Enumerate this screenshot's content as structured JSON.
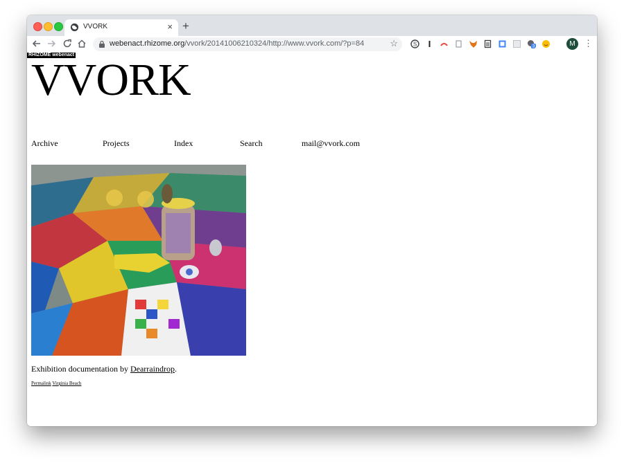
{
  "browser": {
    "tab_title": "VVORK",
    "url_host": "webenact.rhizome.org",
    "url_path": "/vvork/20141006210324/http://www.vvork.com/?p=84",
    "profile_initial": "M",
    "extension_badge": "3"
  },
  "wayback": {
    "badge": "RHIZOME webenact"
  },
  "site": {
    "title": "VVORK",
    "nav": [
      {
        "label": "Archive"
      },
      {
        "label": "Projects"
      },
      {
        "label": "Index"
      },
      {
        "label": "Search"
      },
      {
        "label": "mail@vvork.com"
      }
    ]
  },
  "post": {
    "caption_prefix": "Exhibition documentation by ",
    "caption_link": "Dearraindrop",
    "caption_suffix": ".",
    "permalink": "Permalink",
    "tag": "Virginia Beach"
  },
  "colors": {
    "tabstrip": "#dee1e6",
    "omnibox": "#f1f3f4"
  }
}
